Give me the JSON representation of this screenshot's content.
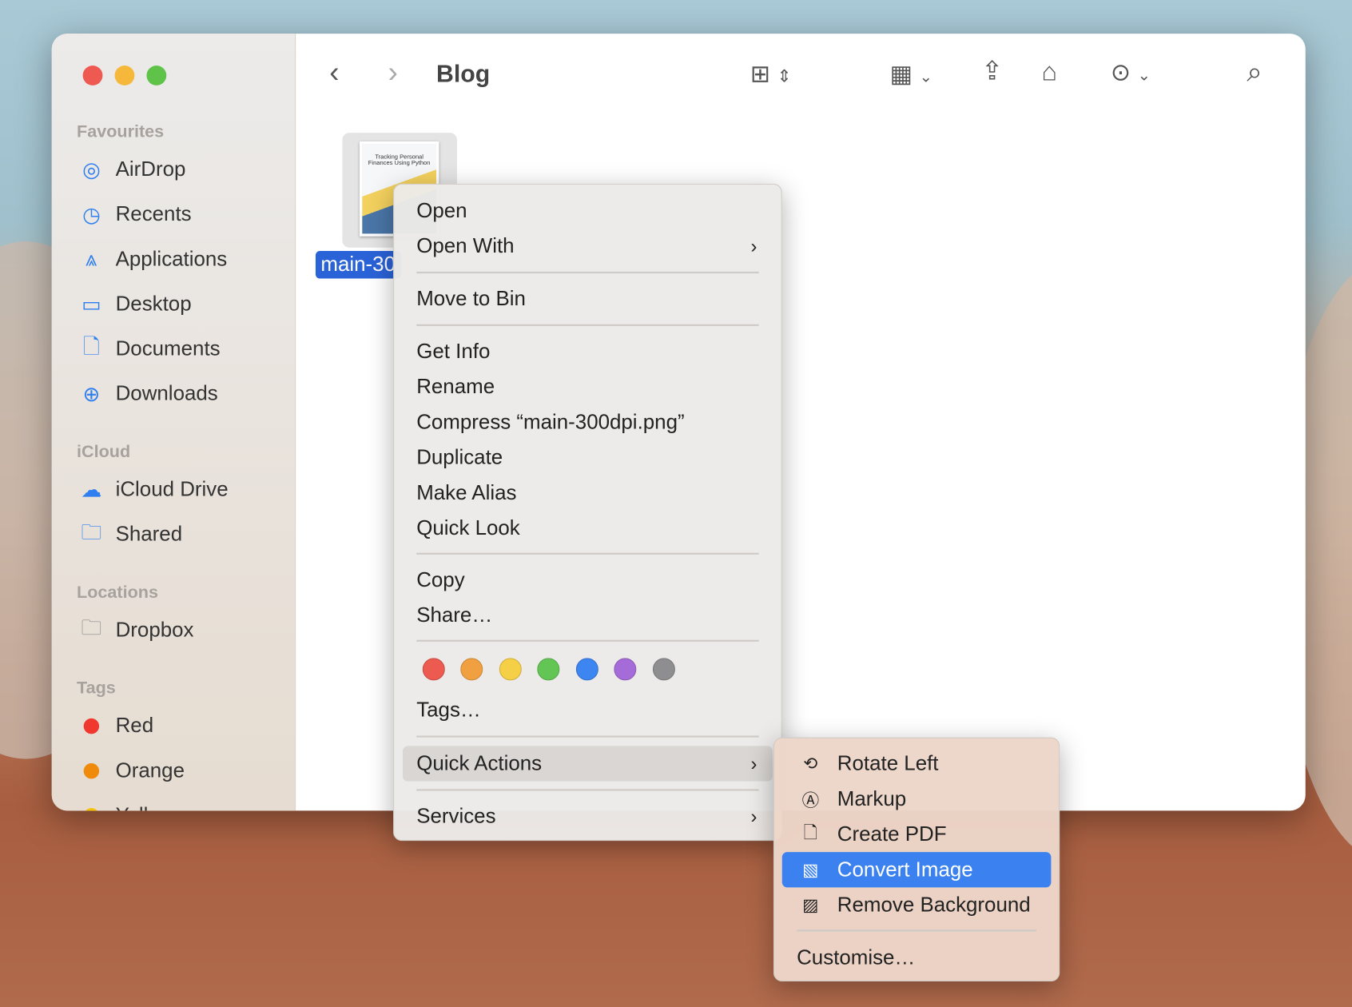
{
  "window": {
    "title": "Blog"
  },
  "sidebar": {
    "sections": [
      {
        "title": "Favourites",
        "items": [
          {
            "label": "AirDrop",
            "icon": "airdrop-icon"
          },
          {
            "label": "Recents",
            "icon": "clock-icon"
          },
          {
            "label": "Applications",
            "icon": "applications-icon"
          },
          {
            "label": "Desktop",
            "icon": "desktop-icon"
          },
          {
            "label": "Documents",
            "icon": "document-icon"
          },
          {
            "label": "Downloads",
            "icon": "download-icon"
          }
        ]
      },
      {
        "title": "iCloud",
        "items": [
          {
            "label": "iCloud Drive",
            "icon": "cloud-icon"
          },
          {
            "label": "Shared",
            "icon": "shared-folder-icon"
          }
        ]
      },
      {
        "title": "Locations",
        "items": [
          {
            "label": "Dropbox",
            "icon": "folder-icon"
          }
        ]
      },
      {
        "title": "Tags",
        "items": [
          {
            "label": "Red",
            "color": "#f0382e"
          },
          {
            "label": "Orange",
            "color": "#f08a0a"
          },
          {
            "label": "Yellow",
            "color": "#f5c400"
          }
        ]
      }
    ]
  },
  "file": {
    "name": "main-30",
    "thumbnail_text": "Tracking Personal Finances Using Python"
  },
  "context_menu": {
    "items": [
      "Open",
      "Open With",
      "Move to Bin",
      "Get Info",
      "Rename",
      "Compress “main-300dpi.png”",
      "Duplicate",
      "Make Alias",
      "Quick Look",
      "Copy",
      "Share…",
      "Tags…",
      "Quick Actions",
      "Services"
    ],
    "tag_colors": [
      "#ec5a50",
      "#f0a040",
      "#f5cf45",
      "#62c554",
      "#3d85f0",
      "#a56bd8",
      "#8e8e90"
    ]
  },
  "quick_actions": {
    "items": [
      {
        "label": "Rotate Left",
        "icon": "rotate-left-icon"
      },
      {
        "label": "Markup",
        "icon": "markup-icon"
      },
      {
        "label": "Create PDF",
        "icon": "pdf-icon"
      },
      {
        "label": "Convert Image",
        "icon": "convert-image-icon",
        "highlighted": true
      },
      {
        "label": "Remove Background",
        "icon": "remove-background-icon"
      }
    ],
    "customise": "Customise…",
    "highlight_color": "#3b82f0"
  }
}
